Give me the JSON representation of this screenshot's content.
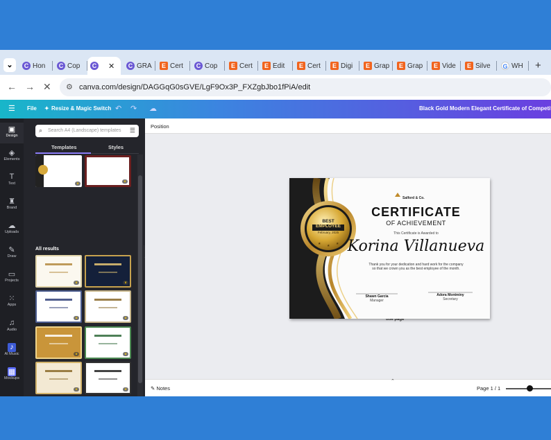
{
  "browser": {
    "tabs": [
      {
        "label": "Hon",
        "icon": "c"
      },
      {
        "label": "Cop",
        "icon": "c"
      },
      {
        "label": "",
        "icon": "c",
        "active": true
      },
      {
        "label": "GRA",
        "icon": "c"
      },
      {
        "label": "Cert",
        "icon": "e"
      },
      {
        "label": "Cop",
        "icon": "c"
      },
      {
        "label": "Cert",
        "icon": "e"
      },
      {
        "label": "Edit",
        "icon": "e"
      },
      {
        "label": "Cert",
        "icon": "e"
      },
      {
        "label": "Digi",
        "icon": "e"
      },
      {
        "label": "Grap",
        "icon": "e"
      },
      {
        "label": "Grap",
        "icon": "e"
      },
      {
        "label": "Vide",
        "icon": "e"
      },
      {
        "label": "Silve",
        "icon": "e"
      },
      {
        "label": "WH",
        "icon": "g"
      }
    ],
    "url": "canva.com/design/DAGGqG0sGVE/LgF9Ox3P_FXZgbJbo1fPiA/edit"
  },
  "header": {
    "file": "File",
    "resize": "Resize & Magic Switch",
    "doc_title": "Black Gold Modern Elegant Certificate of Competition Cer"
  },
  "rail": [
    {
      "label": "Design",
      "glyph": "▣"
    },
    {
      "label": "Elements",
      "glyph": "◈"
    },
    {
      "label": "Text",
      "glyph": "T"
    },
    {
      "label": "Brand",
      "glyph": "♜"
    },
    {
      "label": "Uploads",
      "glyph": "☁"
    },
    {
      "label": "Draw",
      "glyph": "✎"
    },
    {
      "label": "Projects",
      "glyph": "▭"
    },
    {
      "label": "Apps",
      "glyph": "⁙"
    },
    {
      "label": "Audio",
      "glyph": "♫"
    },
    {
      "label": "AI Music",
      "glyph": "♪"
    },
    {
      "label": "Mockups",
      "glyph": "▦"
    }
  ],
  "panel": {
    "search_placeholder": "Search A4 (Landscape) templates",
    "tab_templates": "Templates",
    "tab_styles": "Styles",
    "all_results": "All results"
  },
  "canvas": {
    "position_label": "Position",
    "notes": "Notes",
    "page": "Page 1 / 1",
    "behind_text": "title page"
  },
  "certificate": {
    "company": "Salford & Co.",
    "title": "CERTIFICATE",
    "subtitle": "OF ACHIEVEMENT",
    "awarded": "This Certificate is Awarded to",
    "name": "Korina Villanueva",
    "message1": "Thank you for your dedication and hard work for the company",
    "message2": "so that we crown you as the best employee of the month.",
    "badge1": "BEST",
    "badge2": "EMPLOYEE",
    "badge3": "February, 2025",
    "sign1_name": "Shawn Garcia",
    "sign1_role": "Manager",
    "sign2_name": "Adora Montminy",
    "sign2_role": "Secretary"
  }
}
